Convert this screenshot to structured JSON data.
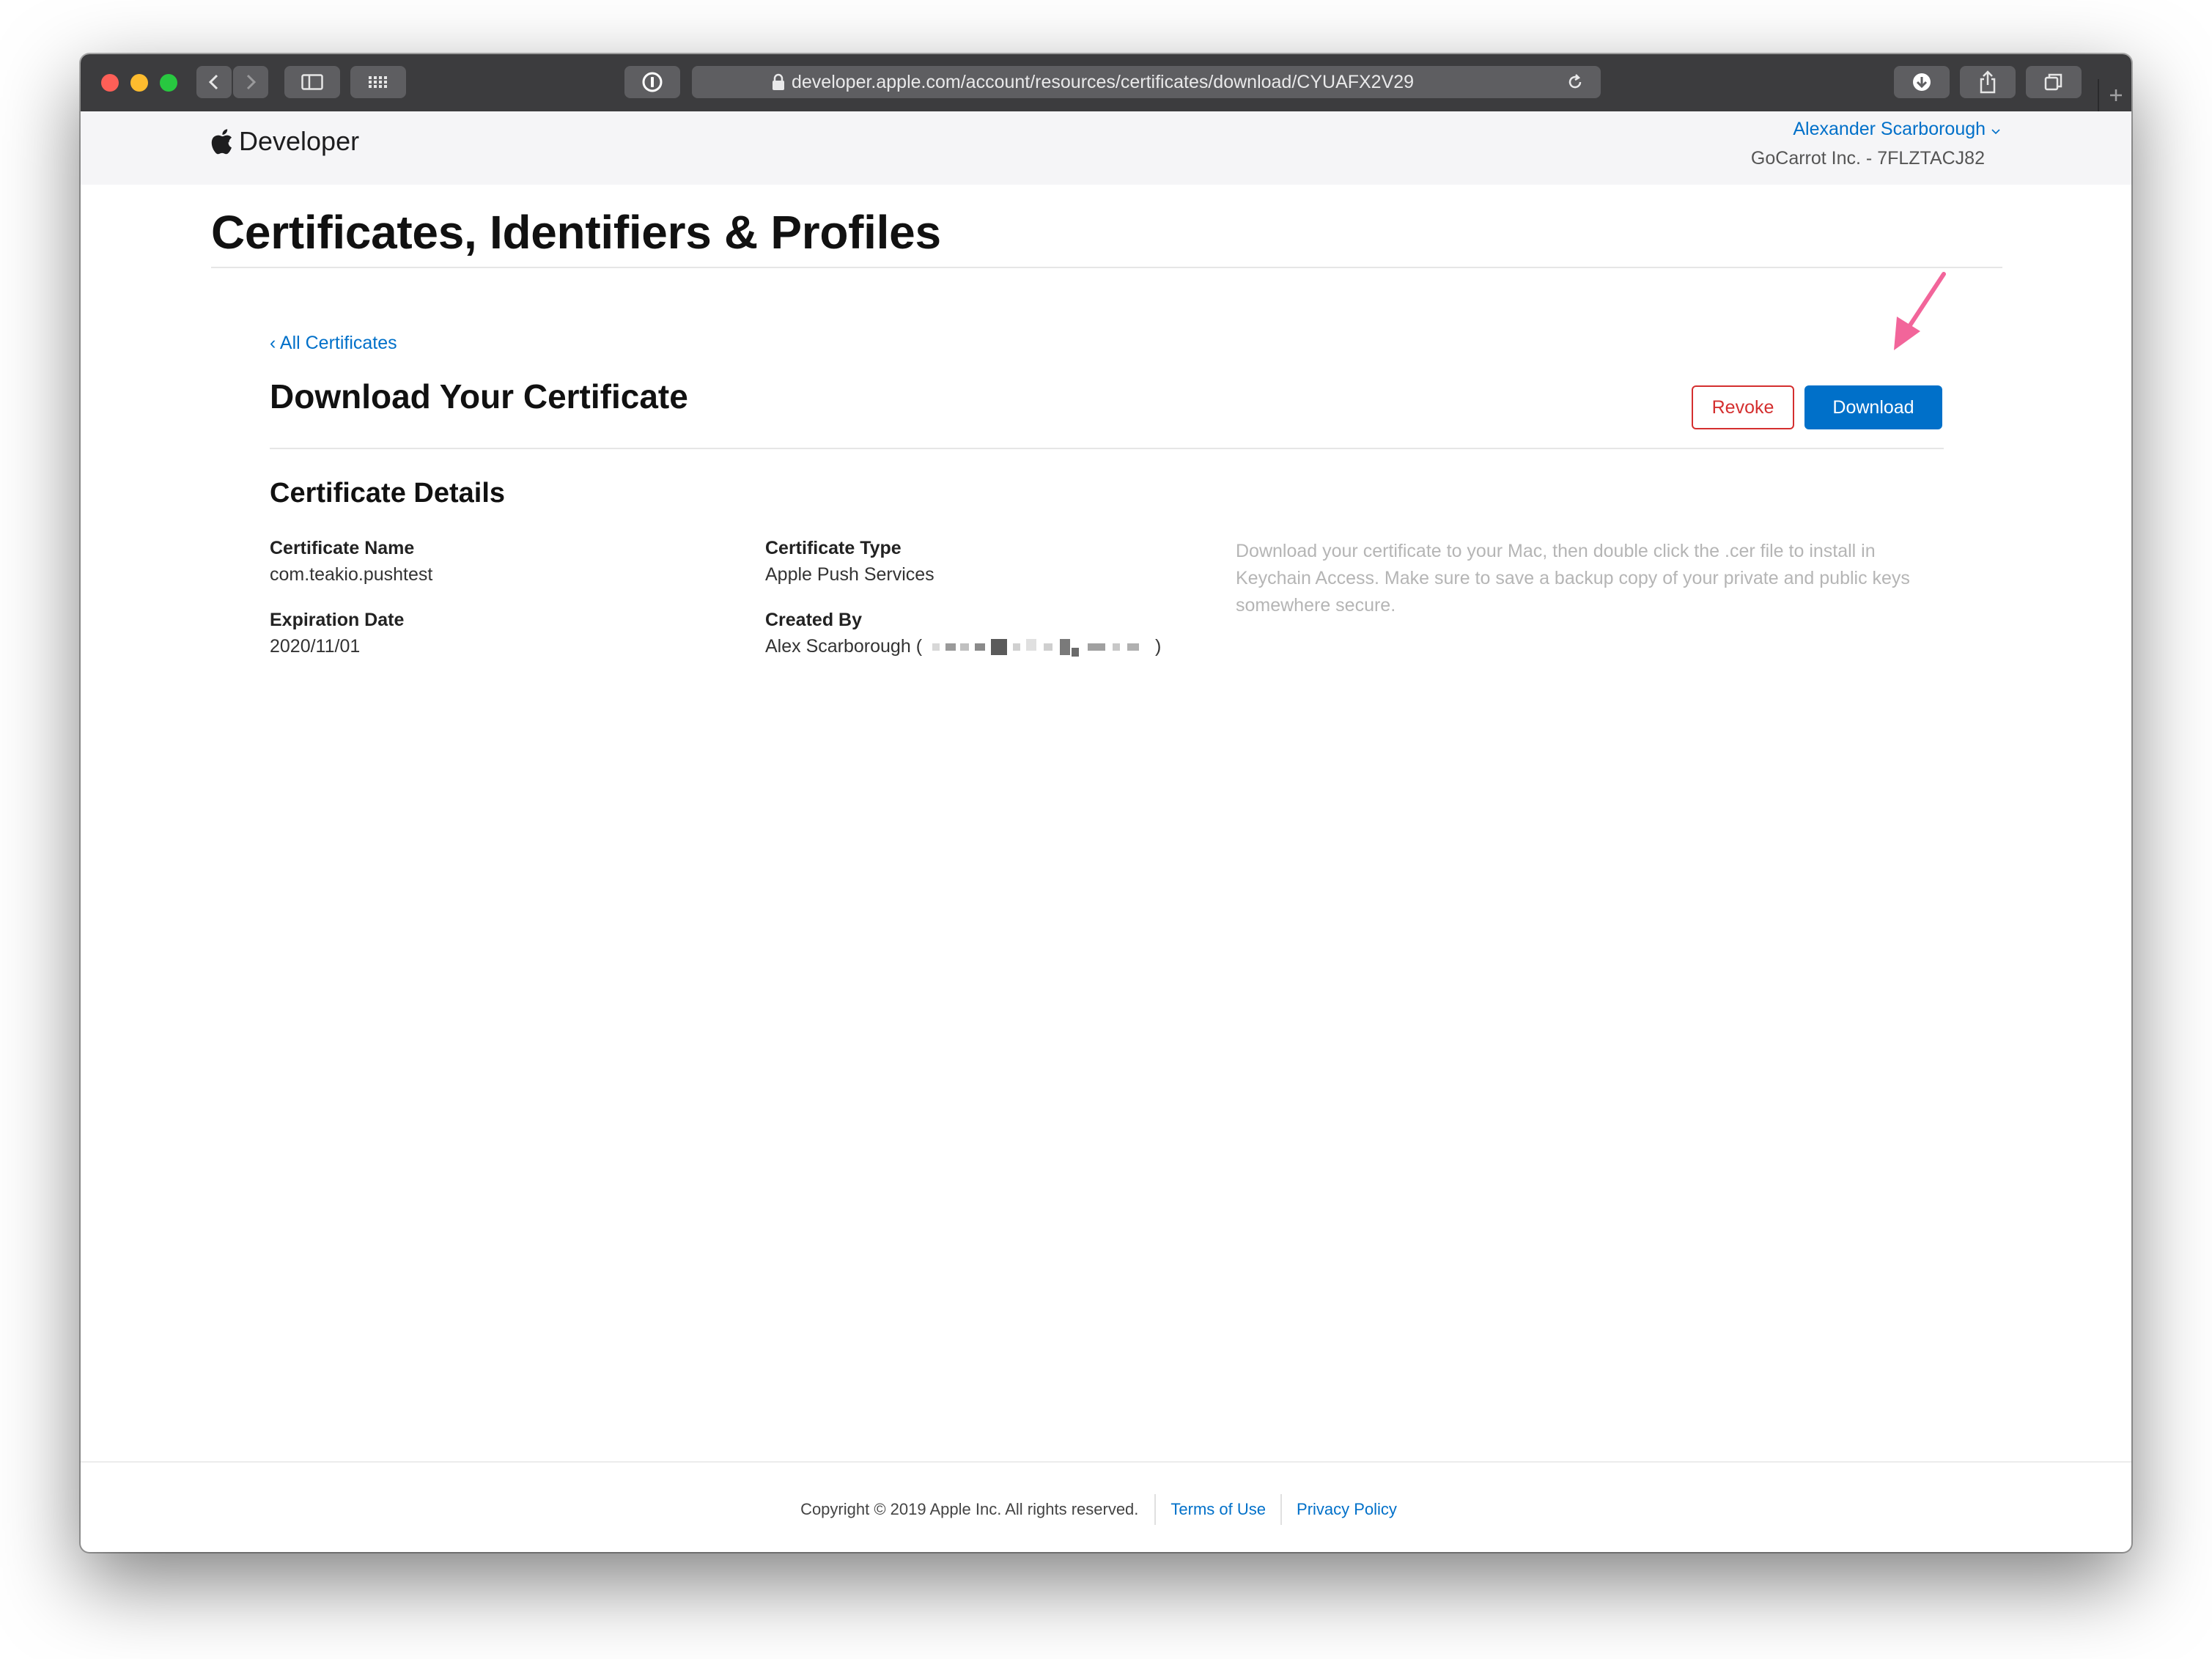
{
  "browser": {
    "url": "developer.apple.com/account/resources/certificates/download/CYUAFX2V29",
    "icons": {
      "back": "chevron-left-icon",
      "forward": "chevron-right-icon",
      "sidebar": "sidebar-icon",
      "grid": "grid-icon",
      "password": "password-key-icon",
      "lock": "lock-icon",
      "reload": "reload-icon",
      "downloads": "download-icon",
      "share": "share-icon",
      "tabs": "tabs-icon",
      "new_tab": "plus-icon"
    }
  },
  "header": {
    "logo_text": "Developer",
    "user_name": "Alexander Scarborough",
    "team": "GoCarrot Inc. - 7FLZTACJ82"
  },
  "page": {
    "title": "Certificates, Identifiers & Profiles",
    "back_link": "‹ All Certificates",
    "section_title": "Download Your Certificate",
    "revoke_label": "Revoke",
    "download_label": "Download",
    "details_title": "Certificate Details",
    "fields": {
      "cert_name_label": "Certificate Name",
      "cert_name_value": "com.teakio.pushtest",
      "cert_type_label": "Certificate Type",
      "cert_type_value": "Apple Push Services",
      "expiration_label": "Expiration Date",
      "expiration_value": "2020/11/01",
      "created_by_label": "Created By",
      "created_by_name": "Alex Scarborough",
      "created_by_open": "(",
      "created_by_close": ")"
    },
    "hint": "Download your certificate to your Mac, then double click the .cer file to install in Keychain Access. Make sure to save a backup copy of your private and public keys somewhere secure."
  },
  "footer": {
    "copyright": "Copyright © 2019 Apple Inc. All rights reserved.",
    "terms": "Terms of Use",
    "privacy": "Privacy Policy"
  },
  "colors": {
    "accent": "#0070c9",
    "danger": "#d42f2f",
    "annotation_arrow": "#f2659a"
  }
}
